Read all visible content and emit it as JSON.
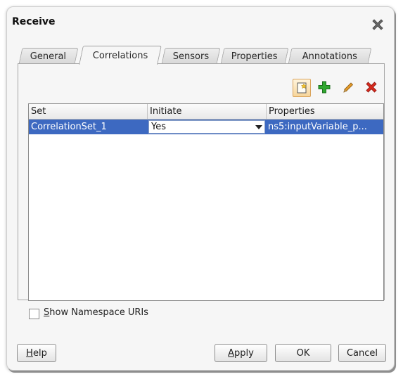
{
  "dialog": {
    "title": "Receive"
  },
  "tabs": [
    {
      "label": "General",
      "active": false
    },
    {
      "label": "Correlations",
      "active": true
    },
    {
      "label": "Sensors",
      "active": false
    },
    {
      "label": "Properties",
      "active": false
    },
    {
      "label": "Annotations",
      "active": false
    }
  ],
  "toolbar": {
    "icons": [
      "new-icon",
      "add-icon",
      "edit-icon",
      "delete-icon"
    ]
  },
  "table": {
    "columns": [
      "Set",
      "Initiate",
      "Properties"
    ],
    "rows": [
      {
        "set": "CorrelationSet_1",
        "initiate": "Yes",
        "properties": "ns5:inputVariable_p..."
      }
    ]
  },
  "options": {
    "show_namespace_mnemonic": "S",
    "show_namespace_rest": "how Namespace URIs",
    "show_namespace_checked": false
  },
  "buttons": {
    "help_mnemonic": "H",
    "help_rest": "elp",
    "apply_mnemonic": "A",
    "apply_rest": "pply",
    "ok": "OK",
    "cancel": "Cancel"
  },
  "colors": {
    "selection": "#3d69c1",
    "add_green": "#2fa82f",
    "delete_red": "#d62a1e",
    "edit_orange": "#e39a2a"
  }
}
